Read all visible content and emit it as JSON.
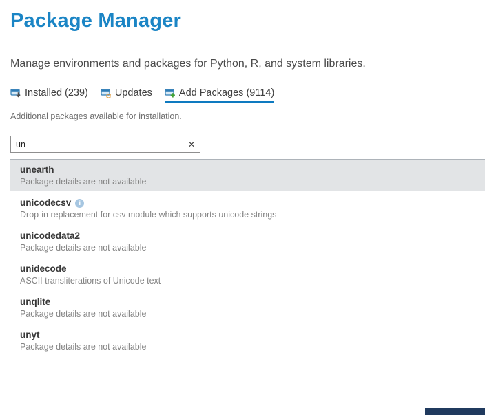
{
  "header": {
    "title": "Package Manager",
    "subtitle": "Manage environments and packages for Python, R, and system libraries."
  },
  "tabs": [
    {
      "label": "Installed (239)",
      "icon": "installed-packages-icon",
      "active": false
    },
    {
      "label": "Updates",
      "icon": "updates-packages-icon",
      "active": false
    },
    {
      "label": "Add Packages (9114)",
      "icon": "add-packages-icon",
      "active": true
    }
  ],
  "add_packages": {
    "description": "Additional packages available for installation.",
    "search": {
      "value": "un"
    }
  },
  "package_list": [
    {
      "name": "unearth",
      "description": "Package details are not available",
      "selected": true,
      "info_icon": false
    },
    {
      "name": "unicodecsv",
      "description": "Drop-in replacement for csv module which supports unicode strings",
      "selected": false,
      "info_icon": true
    },
    {
      "name": "unicodedata2",
      "description": "Package details are not available",
      "selected": false,
      "info_icon": false
    },
    {
      "name": "unidecode",
      "description": "ASCII transliterations of Unicode text",
      "selected": false,
      "info_icon": false
    },
    {
      "name": "unqlite",
      "description": "Package details are not available",
      "selected": false,
      "info_icon": false
    },
    {
      "name": "unyt",
      "description": "Package details are not available",
      "selected": false,
      "info_icon": false
    }
  ],
  "colors": {
    "title_blue": "#1b85c5",
    "tab_underline": "#0e7ac0",
    "selected_row_bg": "#e2e4e6",
    "icon_tray_blue": "#2f7cb5",
    "updates_orange": "#e09b3d",
    "add_green": "#44a336",
    "corner_accent_navy": "#203a5e"
  }
}
